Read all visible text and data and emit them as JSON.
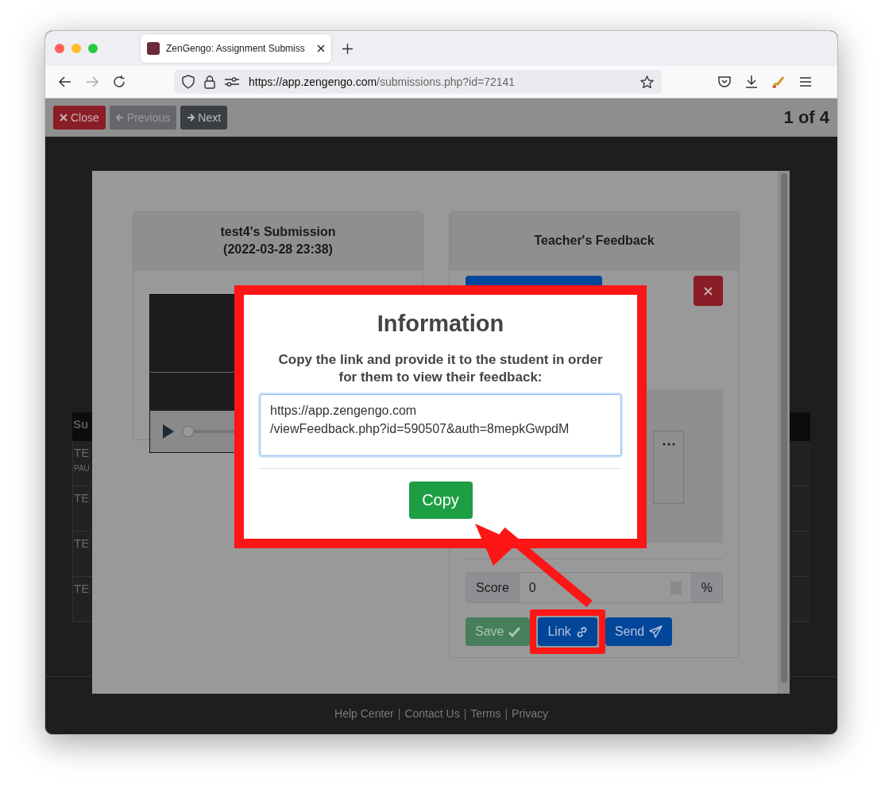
{
  "browser": {
    "tab_title": "ZenGengo: Assignment Submiss",
    "url_host": "https://app.zengengo.com",
    "url_path": "/submissions.php?id=72141"
  },
  "nav_bar": {
    "buttons": [
      {
        "label": "Close",
        "kind": "danger"
      },
      {
        "label": "Previous",
        "kind": "disabled"
      },
      {
        "label": "Next",
        "kind": "dark"
      }
    ],
    "counter": "1 of 4"
  },
  "background_table": {
    "header": "Su",
    "rows": [
      {
        "cell": "TE",
        "note": "PAU"
      },
      {
        "cell": "TE"
      },
      {
        "cell": "TE"
      },
      {
        "cell": "TE"
      }
    ]
  },
  "footer_links": [
    {
      "text": "Help Center",
      "kind": "link"
    },
    {
      "text": "|",
      "kind": "separator"
    },
    {
      "text": "Contact Us",
      "kind": "link"
    },
    {
      "text": "|",
      "kind": "separator"
    },
    {
      "text": "Terms",
      "kind": "link"
    },
    {
      "text": "|",
      "kind": "separator"
    },
    {
      "text": "Privacy",
      "kind": "link"
    }
  ],
  "submission": {
    "title": "test4's Submission",
    "date": "(2022-03-28 23:38)",
    "player": {
      "level": 0
    }
  },
  "feedback": {
    "title": "Teacher's Feedback",
    "score_label": "Score",
    "score_value": "0",
    "score_unit": "%",
    "buttons": [
      {
        "label": "Save",
        "kind": "success",
        "highlighted": false
      },
      {
        "label": "Link",
        "kind": "primary",
        "highlighted": true
      },
      {
        "label": "Send",
        "kind": "primary",
        "highlighted": false
      }
    ]
  },
  "info_dialog": {
    "title": "Information",
    "message": "Copy the link and provide it to the student in order for them to view their feedback:",
    "link": "https://app.zengengo.com\n/viewFeedback.php?id=590507&auth=8mepkGwpdM",
    "copy_label": "Copy"
  }
}
